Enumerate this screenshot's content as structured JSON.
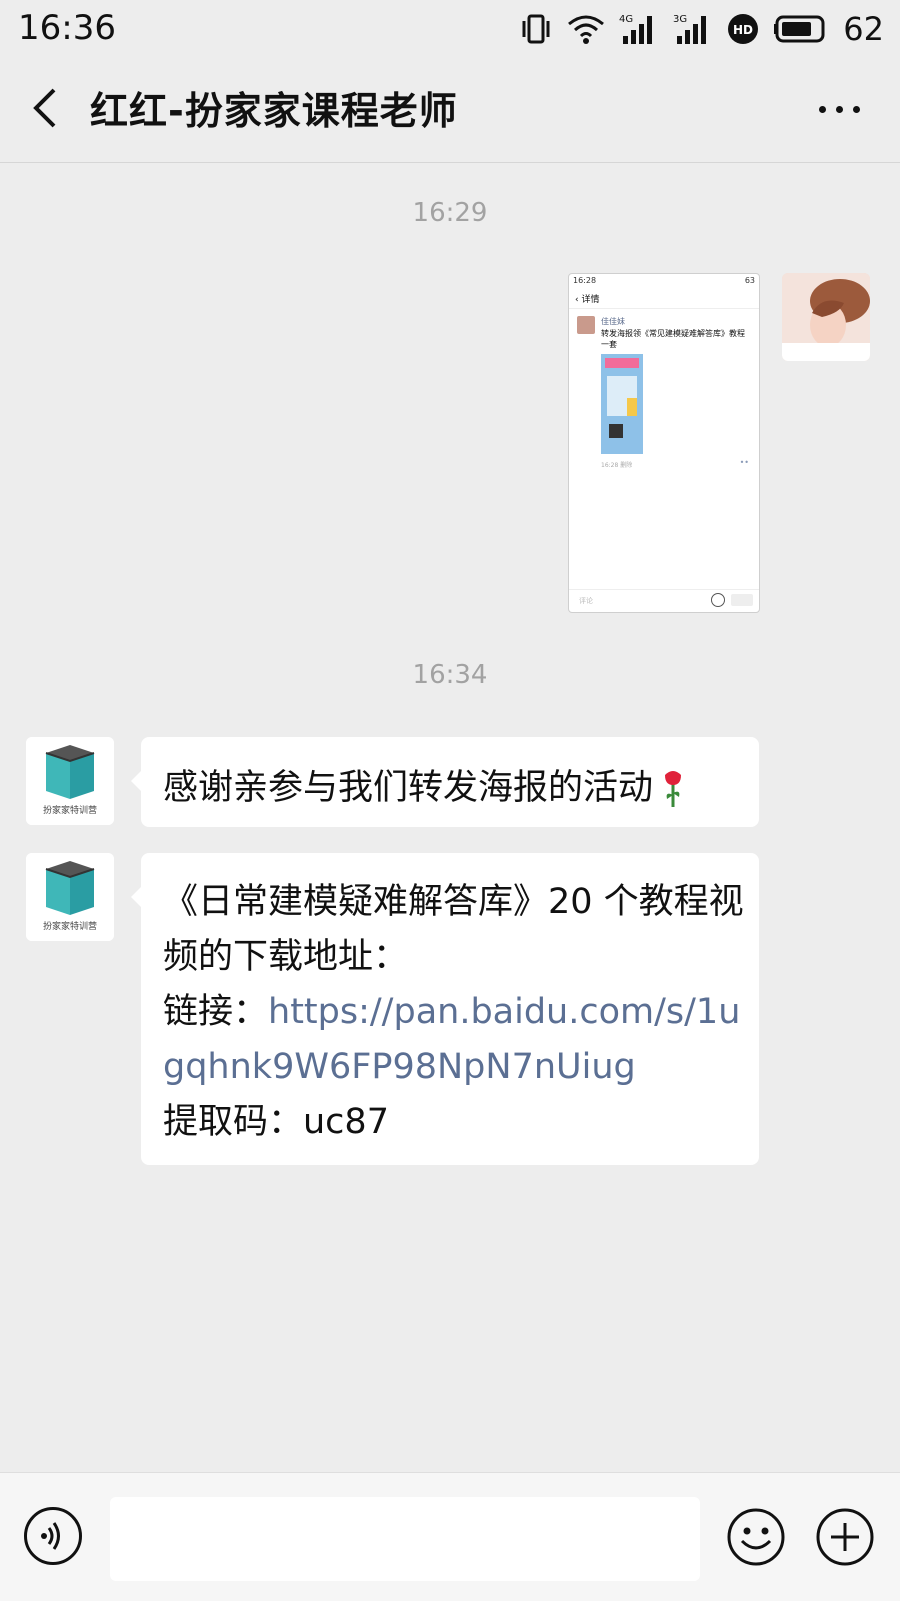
{
  "status_bar": {
    "time": "16:36",
    "battery": "62",
    "net_4g": "4G",
    "net_3g": "3G",
    "hd": "HD"
  },
  "header": {
    "title": "红红-扮家家课程老师"
  },
  "messages": [
    {
      "timestamp": "16:29",
      "sender": "self",
      "type": "image",
      "screenshot": {
        "time": "16:28",
        "battery": "63",
        "header": "详情",
        "poster_name": "佳佳妹",
        "poster_text": "转发海报领《常见建模疑难解答库》教程一套",
        "meta": "16:28  删除",
        "comment_placeholder": "评论"
      }
    },
    {
      "timestamp": "16:34",
      "sender": "other",
      "type": "text",
      "text": "感谢亲参与我们转发海报的活动"
    },
    {
      "sender": "other",
      "type": "text",
      "line1": "《日常建模疑难解答库》20 个教程视频的下载地址：",
      "link_label": "链接：",
      "link": "https://pan.baidu.com/s/1ugqhnk9W6FP98NpN7nUiug",
      "code_line": "提取码：uc87"
    }
  ],
  "avatar_logo_text": "扮家家特训营",
  "input": {
    "value": "",
    "placeholder": ""
  },
  "colors": {
    "background": "#ededed",
    "bubble": "#ffffff",
    "link": "#5b6f93",
    "timestamp": "#a2a2a2"
  },
  "icons": [
    "back-icon",
    "more-icon",
    "voice-icon",
    "emoji-icon",
    "plus-icon",
    "vibrate-icon",
    "wifi-icon",
    "signal-icon",
    "hd-icon",
    "battery-icon",
    "rose-icon"
  ]
}
